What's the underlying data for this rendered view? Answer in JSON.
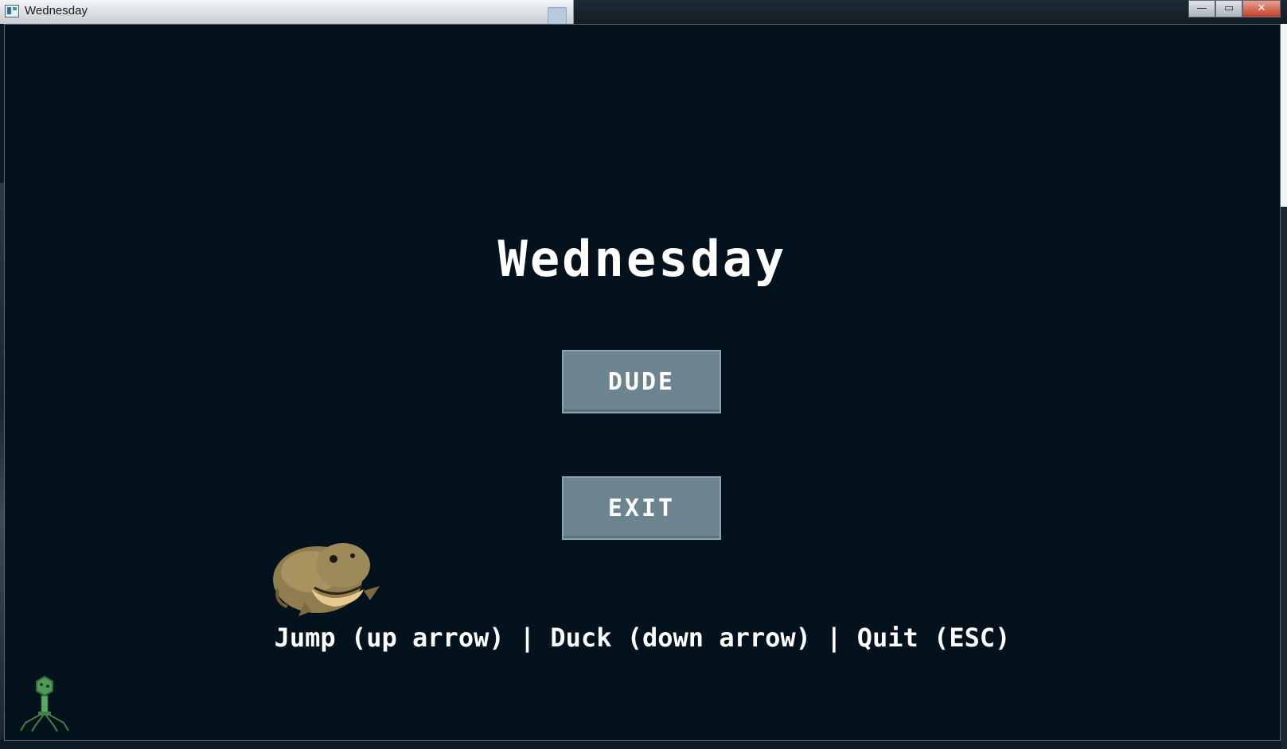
{
  "window": {
    "title": "Wednesday",
    "buttons": {
      "minimize": "—",
      "maximize": "▭",
      "close": "✕"
    }
  },
  "game": {
    "title": "Wednesday",
    "menu": [
      {
        "label": "DUDE"
      },
      {
        "label": "EXIT"
      }
    ],
    "controls": "Jump (up arrow) | Duck (down arrow) | Quit (ESC)",
    "sprites": [
      "frog-sprite",
      "virus-sprite"
    ]
  },
  "colors": {
    "background": "#03121c",
    "button": "#6b8490",
    "text": "#ffffff"
  }
}
